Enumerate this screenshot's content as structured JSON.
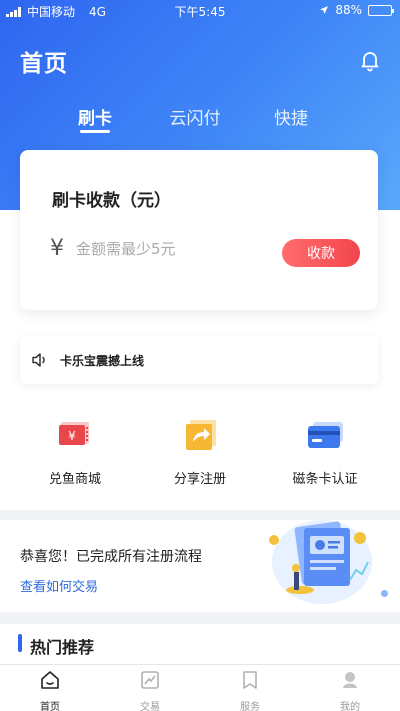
{
  "status_bar": {
    "carrier": "中国移动",
    "network": "4G",
    "time": "下午5:45",
    "battery_percent": "88%",
    "battery_level": 0.88
  },
  "header": {
    "title": "首页"
  },
  "tabs": [
    {
      "label": "刷卡",
      "active": true
    },
    {
      "label": "云闪付",
      "active": false
    },
    {
      "label": "快捷",
      "active": false
    }
  ],
  "payment_card": {
    "title": "刷卡收款（元）",
    "currency_symbol": "¥",
    "amount_placeholder": "金额需最少5元",
    "amount_value": "",
    "collect_button": "收款"
  },
  "notice": {
    "text": "卡乐宝震撼上线"
  },
  "functions": [
    {
      "label": "兑鱼商城",
      "icon": "shop-icon"
    },
    {
      "label": "分享注册",
      "icon": "share-icon"
    },
    {
      "label": "磁条卡认证",
      "icon": "card-icon"
    }
  ],
  "promo": {
    "title": "恭喜您！已完成所有注册流程",
    "link": "查看如何交易"
  },
  "section": {
    "title": "热门推荐"
  },
  "bottom_nav": [
    {
      "label": "首页",
      "icon": "home-icon",
      "active": true
    },
    {
      "label": "交易",
      "icon": "trade-icon",
      "active": false
    },
    {
      "label": "服务",
      "icon": "service-icon",
      "active": false
    },
    {
      "label": "我的",
      "icon": "profile-icon",
      "active": false
    }
  ],
  "colors": {
    "brand_blue": "#2f66f0",
    "button_red": "#f2464d",
    "link_blue": "#2f6bdf"
  }
}
